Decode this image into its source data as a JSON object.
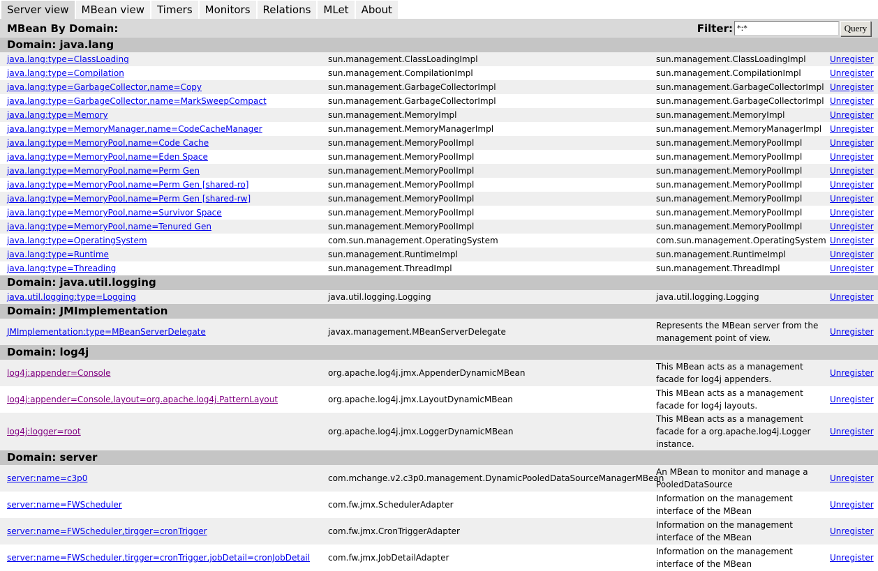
{
  "tabs": [
    {
      "label": "Server view",
      "active": true
    },
    {
      "label": "MBean view"
    },
    {
      "label": "Timers"
    },
    {
      "label": "Monitors"
    },
    {
      "label": "Relations"
    },
    {
      "label": "MLet"
    },
    {
      "label": "About"
    }
  ],
  "header": {
    "title": "MBean By Domain:",
    "filter_label": "Filter:",
    "filter_value": "*:*",
    "query_label": "Query"
  },
  "colors": {
    "link": "#0000ee",
    "visited_link": "#800080",
    "domain_bar": "#c5c5c5",
    "header_bar": "#d9d9d9",
    "stripe": "#efefef"
  },
  "domains": [
    {
      "title": "Domain: java.lang",
      "rows": [
        {
          "name": "java.lang:type=ClassLoading",
          "class": "sun.management.ClassLoadingImpl",
          "desc": "sun.management.ClassLoadingImpl",
          "action": "Unregister"
        },
        {
          "name": "java.lang:type=Compilation",
          "class": "sun.management.CompilationImpl",
          "desc": "sun.management.CompilationImpl",
          "action": "Unregister"
        },
        {
          "name": "java.lang:type=GarbageCollector,name=Copy",
          "class": "sun.management.GarbageCollectorImpl",
          "desc": "sun.management.GarbageCollectorImpl",
          "action": "Unregister"
        },
        {
          "name": "java.lang:type=GarbageCollector,name=MarkSweepCompact",
          "class": "sun.management.GarbageCollectorImpl",
          "desc": "sun.management.GarbageCollectorImpl",
          "action": "Unregister"
        },
        {
          "name": "java.lang:type=Memory",
          "class": "sun.management.MemoryImpl",
          "desc": "sun.management.MemoryImpl",
          "action": "Unregister"
        },
        {
          "name": "java.lang:type=MemoryManager,name=CodeCacheManager",
          "class": "sun.management.MemoryManagerImpl",
          "desc": "sun.management.MemoryManagerImpl",
          "action": "Unregister"
        },
        {
          "name": "java.lang:type=MemoryPool,name=Code Cache",
          "class": "sun.management.MemoryPoolImpl",
          "desc": "sun.management.MemoryPoolImpl",
          "action": "Unregister"
        },
        {
          "name": "java.lang:type=MemoryPool,name=Eden Space",
          "class": "sun.management.MemoryPoolImpl",
          "desc": "sun.management.MemoryPoolImpl",
          "action": "Unregister"
        },
        {
          "name": "java.lang:type=MemoryPool,name=Perm Gen",
          "class": "sun.management.MemoryPoolImpl",
          "desc": "sun.management.MemoryPoolImpl",
          "action": "Unregister"
        },
        {
          "name": "java.lang:type=MemoryPool,name=Perm Gen [shared-ro]",
          "class": "sun.management.MemoryPoolImpl",
          "desc": "sun.management.MemoryPoolImpl",
          "action": "Unregister"
        },
        {
          "name": "java.lang:type=MemoryPool,name=Perm Gen [shared-rw]",
          "class": "sun.management.MemoryPoolImpl",
          "desc": "sun.management.MemoryPoolImpl",
          "action": "Unregister"
        },
        {
          "name": "java.lang:type=MemoryPool,name=Survivor Space",
          "class": "sun.management.MemoryPoolImpl",
          "desc": "sun.management.MemoryPoolImpl",
          "action": "Unregister"
        },
        {
          "name": "java.lang:type=MemoryPool,name=Tenured Gen",
          "class": "sun.management.MemoryPoolImpl",
          "desc": "sun.management.MemoryPoolImpl",
          "action": "Unregister"
        },
        {
          "name": "java.lang:type=OperatingSystem",
          "class": "com.sun.management.OperatingSystem",
          "desc": "com.sun.management.OperatingSystem",
          "action": "Unregister"
        },
        {
          "name": "java.lang:type=Runtime",
          "class": "sun.management.RuntimeImpl",
          "desc": "sun.management.RuntimeImpl",
          "action": "Unregister"
        },
        {
          "name": "java.lang:type=Threading",
          "class": "sun.management.ThreadImpl",
          "desc": "sun.management.ThreadImpl",
          "action": "Unregister"
        }
      ]
    },
    {
      "title": "Domain: java.util.logging",
      "rows": [
        {
          "name": "java.util.logging:type=Logging",
          "class": "java.util.logging.Logging",
          "desc": "java.util.logging.Logging",
          "action": "Unregister"
        }
      ]
    },
    {
      "title": "Domain: JMImplementation",
      "rows": [
        {
          "name": "JMImplementation:type=MBeanServerDelegate",
          "class": "javax.management.MBeanServerDelegate",
          "desc": "Represents the MBean server from the management point of view.",
          "action": "Unregister",
          "lines": 2
        }
      ]
    },
    {
      "title": "Domain: log4j",
      "rows": [
        {
          "name": "log4j:appender=Console",
          "class": "org.apache.log4j.jmx.AppenderDynamicMBean",
          "desc": "This MBean acts as a management facade for log4j appenders.",
          "action": "Unregister",
          "visited": true,
          "lines": 2
        },
        {
          "name": "log4j:appender=Console,layout=org.apache.log4j.PatternLayout",
          "class": "org.apache.log4j.jmx.LayoutDynamicMBean",
          "desc": "This MBean acts as a management facade for log4j layouts.",
          "action": "Unregister",
          "visited": true,
          "lines": 2
        },
        {
          "name": "log4j:logger=root",
          "class": "org.apache.log4j.jmx.LoggerDynamicMBean",
          "desc": "This MBean acts as a management facade for a org.apache.log4j.Logger instance.",
          "action": "Unregister",
          "visited": true,
          "lines": 3
        }
      ]
    },
    {
      "title": "Domain: server",
      "rows": [
        {
          "name": "server:name=c3p0",
          "class": "com.mchange.v2.c3p0.management.DynamicPooledDataSourceManagerMBean",
          "desc": "An MBean to monitor and manage a PooledDataSource",
          "action": "Unregister",
          "lines": 2
        },
        {
          "name": "server:name=FWScheduler",
          "class": "com.fw.jmx.SchedulerAdapter",
          "desc": "Information on the management interface of the MBean",
          "action": "Unregister",
          "lines": 2
        },
        {
          "name": "server:name=FWScheduler,tirgger=cronTrigger",
          "class": "com.fw.jmx.CronTriggerAdapter",
          "desc": "Information on the management interface of the MBean",
          "action": "Unregister",
          "lines": 2
        },
        {
          "name": "server:name=FWScheduler,tirgger=cronTrigger,jobDetail=cronJobDetail",
          "class": "com.fw.jmx.JobDetailAdapter",
          "desc": "Information on the management interface of the MBean",
          "action": "Unregister",
          "lines": 2
        }
      ]
    }
  ]
}
